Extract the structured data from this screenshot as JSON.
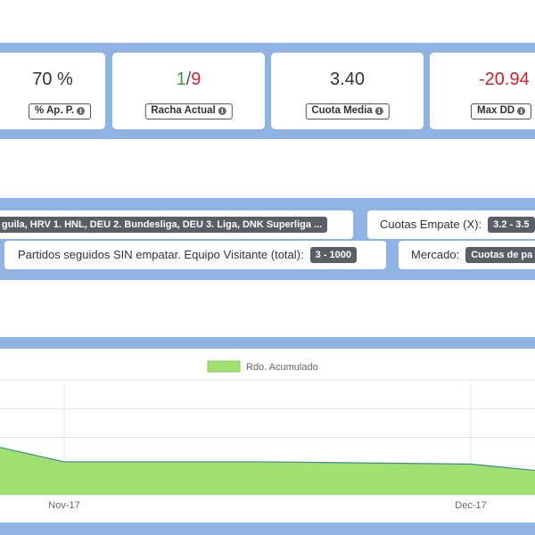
{
  "stats": [
    {
      "value": "70 %",
      "label": "% Ap. P."
    },
    {
      "win": "1",
      "sep": "/",
      "loss": "9",
      "label": "Racha Actual"
    },
    {
      "value": "3.40",
      "label": "Cuota Media"
    },
    {
      "value": "-20.94",
      "label": "Max DD"
    }
  ],
  "filters": {
    "leagues": "guila, HRV 1. HNL, DEU 2. Bundesliga, DEU 3. Liga, DNK Superliga ...",
    "cuotas_empate_label": "Cuotas Empate (X):",
    "cuotas_empate_value": "3.2 - 3.5",
    "partidos_label": "Partidos seguidos SIN empatar. Equipo Visitante (total):",
    "partidos_value": "3 - 1000",
    "mercado_label": "Mercado:",
    "mercado_value": "Cuotas de pa"
  },
  "colors": {
    "band": "#8fb3e2",
    "area_fill": "#9fe070",
    "area_line": "#3c8c8c",
    "positive": "#3a9b3a",
    "negative": "#d0202b"
  },
  "chart_data": {
    "type": "area",
    "legend": {
      "label": "Rdo. Acumulado",
      "placement": "top-center"
    },
    "x_ticks": [
      "Nov-17",
      "Dec-17"
    ],
    "series": [
      {
        "name": "Rdo. Acumulado",
        "values": [
          -8.5,
          -13.5,
          -13.5,
          -14.3,
          -16.5
        ]
      }
    ],
    "ylim": [
      -25,
      15
    ],
    "grid": true
  }
}
